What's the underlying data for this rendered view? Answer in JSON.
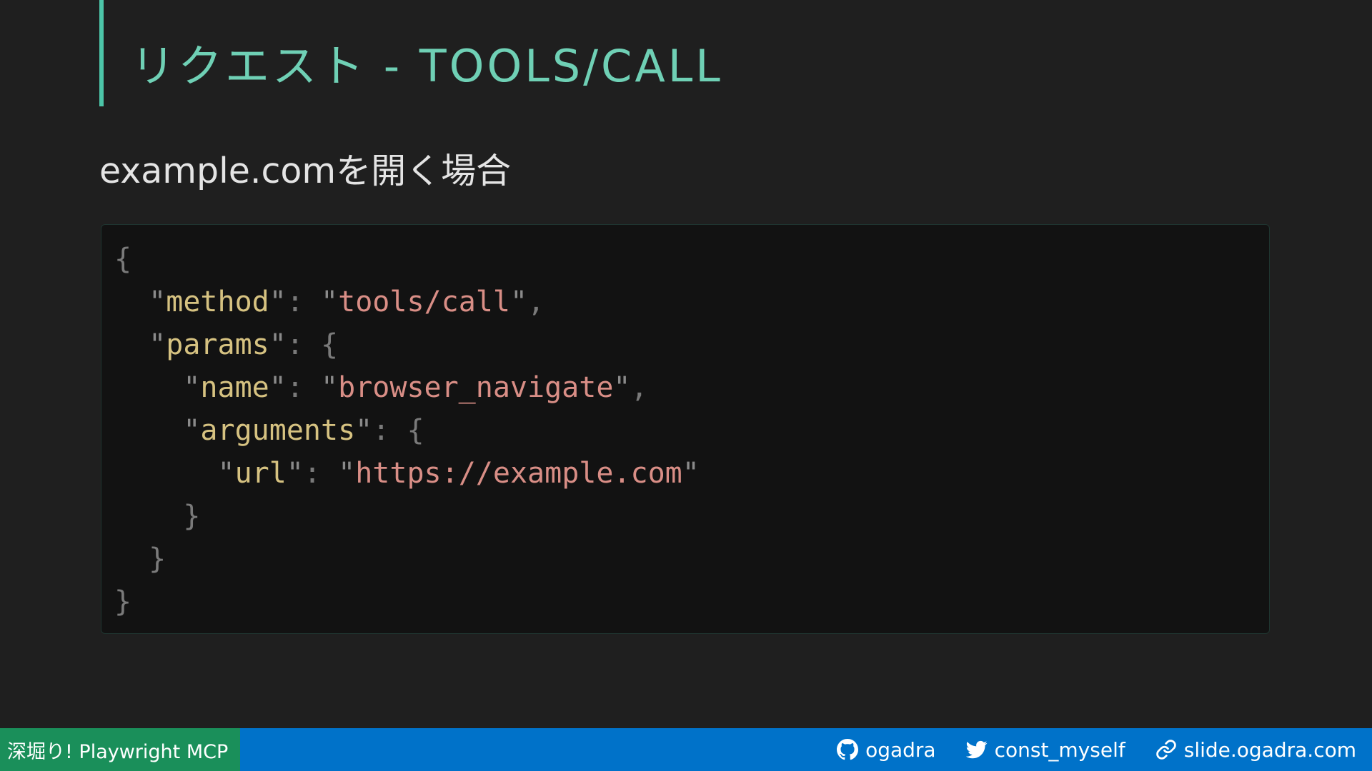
{
  "slide": {
    "title": "リクエスト - TOOLS/CALL",
    "subtitle": "example.comを開く場合"
  },
  "code": {
    "language": "json",
    "open_brace": "{",
    "method_key": "method",
    "method_value": "tools/call",
    "params_key": "params",
    "name_key": "name",
    "name_value": "browser_navigate",
    "arguments_key": "arguments",
    "url_key": "url",
    "url_value": "https://example.com",
    "close_brace": "}"
  },
  "footer": {
    "presentation_title": "深堀り! Playwright MCP",
    "github_handle": "ogadra",
    "twitter_handle": "const_myself",
    "website": "slide.ogadra.com",
    "icons": [
      "github-icon",
      "twitter-icon",
      "link-icon"
    ]
  },
  "colors": {
    "background": "#1f1f1f",
    "title_accent": "#6fd0b5",
    "code_background": "#121212",
    "json_key": "#d6c281",
    "json_string": "#d98e86",
    "footer_blue": "#0072c9",
    "footer_green": "#1a8f5a"
  }
}
